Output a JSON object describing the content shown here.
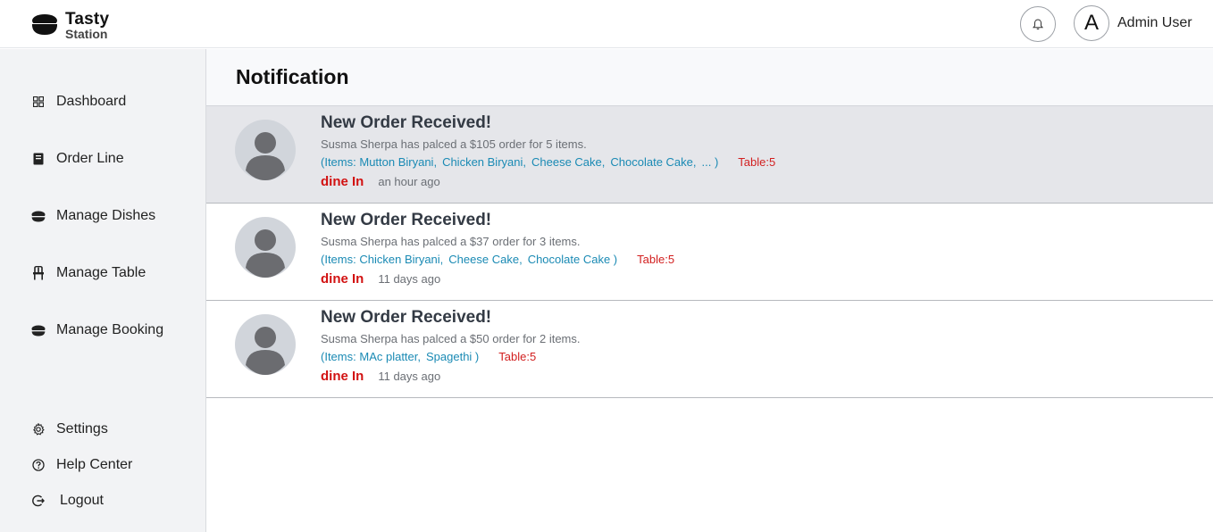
{
  "brand": {
    "title": "Tasty",
    "subtitle": "Station"
  },
  "header": {
    "user_initial": "A",
    "user_name": "Admin User"
  },
  "sidebar": {
    "items": [
      {
        "label": "Dashboard",
        "icon": "grid-icon"
      },
      {
        "label": "Order Line",
        "icon": "book-icon"
      },
      {
        "label": "Manage Dishes",
        "icon": "bowl-icon"
      },
      {
        "label": "Manage Table",
        "icon": "chair-icon"
      },
      {
        "label": "Manage Booking",
        "icon": "bowl-icon"
      }
    ],
    "bottom": [
      {
        "label": "Settings",
        "icon": "gear-icon"
      },
      {
        "label": "Help Center",
        "icon": "question-icon"
      },
      {
        "label": "Logout",
        "icon": "logout-icon"
      }
    ]
  },
  "page": {
    "title": "Notification"
  },
  "notifications": [
    {
      "title": "New Order Received!",
      "description": "Susma Sherpa has palced a $105 order for 5 items.",
      "items_prefix": "(Items:",
      "items": [
        "Mutton Biryani,",
        "Chicken Biryani,",
        "Cheese Cake,",
        "Chocolate Cake,",
        "... )"
      ],
      "table": "Table:5",
      "type": "dine In",
      "time": "an hour ago",
      "unread": true
    },
    {
      "title": "New Order Received!",
      "description": "Susma Sherpa has palced a $37 order for 3 items.",
      "items_prefix": "(Items:",
      "items": [
        "Chicken Biryani,",
        "Cheese Cake,",
        "Chocolate Cake  )"
      ],
      "table": "Table:5",
      "type": "dine In",
      "time": "11 days ago",
      "unread": false
    },
    {
      "title": "New Order Received!",
      "description": "Susma Sherpa has palced a $50 order for 2 items.",
      "items_prefix": "(Items:",
      "items": [
        "MAc platter,",
        "Spagethi  )"
      ],
      "table": "Table:5",
      "type": "dine In",
      "time": "11 days ago",
      "unread": false
    }
  ],
  "colors": {
    "accent_link": "#1a8ab4",
    "alert_red": "#d21212",
    "unread_bg": "#e5e6ea",
    "sidebar_bg": "#f2f3f5"
  }
}
